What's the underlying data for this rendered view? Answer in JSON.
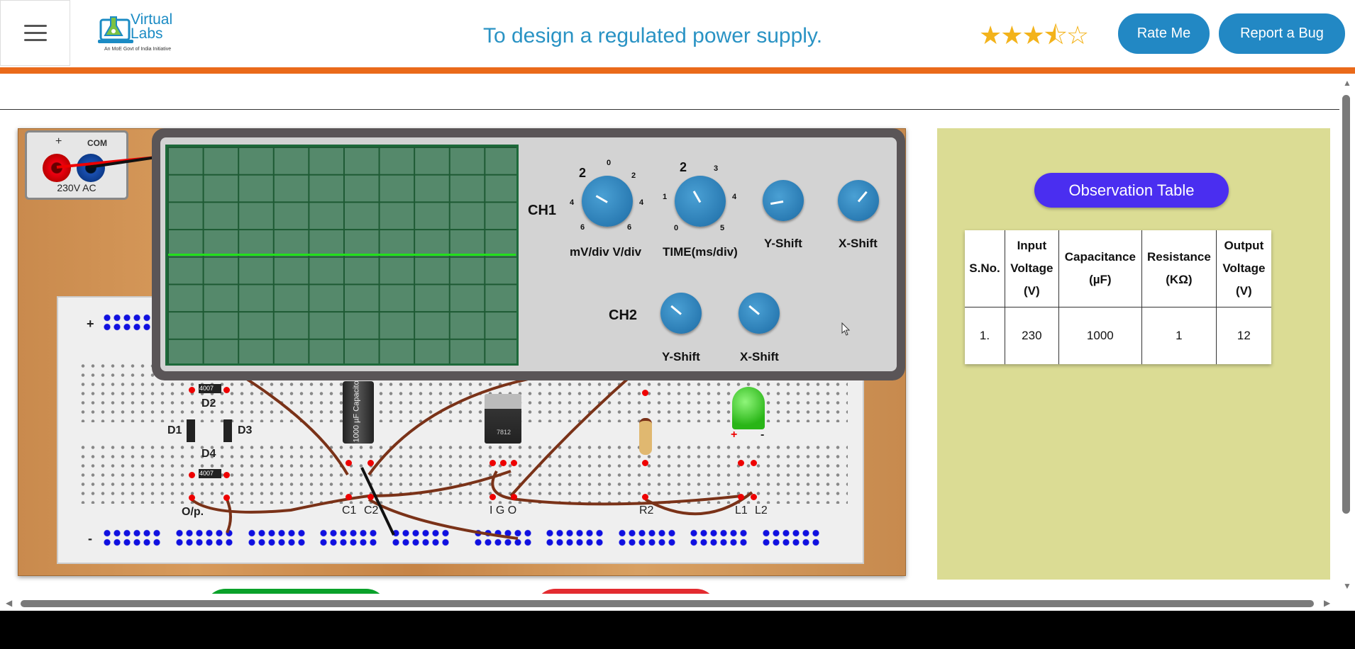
{
  "header": {
    "menu_icon": "hamburger-icon",
    "logo_text": "Virtual Labs",
    "logo_tagline": "An MoE Govt of India Initiative",
    "title": "To design a regulated power supply.",
    "rating": 3.5,
    "rating_stars": "★★★⯪☆",
    "rate_button": "Rate Me",
    "report_button": "Report a Bug"
  },
  "colors": {
    "accent_orange": "#ea6a1a",
    "button_blue": "#2288c4",
    "title_blue": "#2a93c4",
    "panel_bg": "#dbdc94",
    "observation_button": "#4a2ef0",
    "scope_screen": "#55896b",
    "trace": "#22e01a"
  },
  "power_supply": {
    "plus": "+",
    "com": "COM",
    "label": "230V AC"
  },
  "oscilloscope": {
    "ch1": "CH1",
    "ch2": "CH2",
    "ch1_labels": {
      "volts": "mV/div  V/div",
      "time": "TIME(ms/div)",
      "y_shift": "Y-Shift",
      "x_shift": "X-Shift"
    },
    "ch2_labels": {
      "y_shift": "Y-Shift",
      "x_shift": "X-Shift"
    },
    "volt_ticks": [
      "2",
      "0",
      "2",
      "4",
      "4",
      "6",
      "6"
    ],
    "time_ticks": [
      "2",
      "3",
      "1",
      "4",
      "0",
      "5"
    ]
  },
  "breadboard": {
    "plus": "+",
    "minus": "-",
    "diodes": [
      "D1",
      "D2",
      "D3",
      "D4"
    ],
    "diode_part": "4007",
    "capacitor": "1000 µF Capacitor",
    "regulator": "7812",
    "labels": {
      "op": "O/p.",
      "c1": "C1",
      "c2": "C2",
      "igo": "I G O",
      "r2": "R2",
      "l1": "L1",
      "l2": "L2",
      "led_plus": "+",
      "led_minus": "-"
    }
  },
  "observation": {
    "button": "Observation Table",
    "headers": [
      "S.No.",
      "Input Voltage (V)",
      "Capacitance (µF)",
      "Resistance (KΩ)",
      "Output Voltage (V)"
    ],
    "rows": [
      [
        "1.",
        "230",
        "1000",
        "1",
        "12"
      ]
    ]
  }
}
